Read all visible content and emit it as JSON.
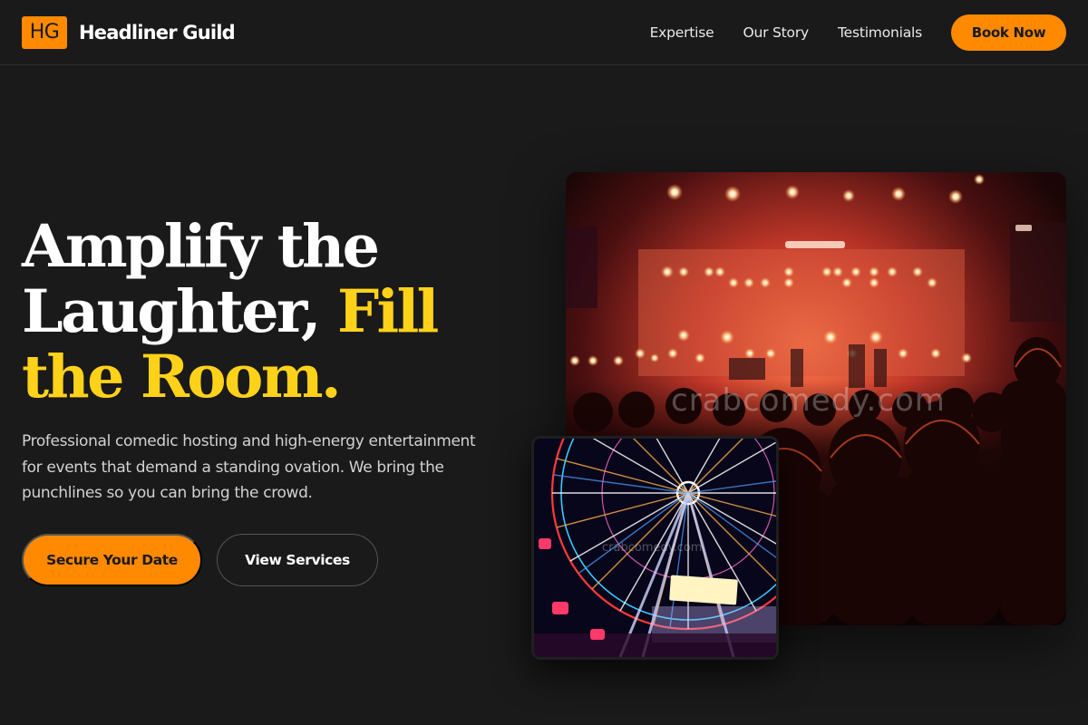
{
  "header": {
    "logo_mark": "HG",
    "brand_name": "Headliner Guild",
    "nav": [
      {
        "label": "Expertise"
      },
      {
        "label": "Our Story"
      },
      {
        "label": "Testimonials"
      }
    ],
    "cta_label": "Book Now"
  },
  "hero": {
    "title_line1": "Amplify the",
    "title_line2_plain": "Laughter, ",
    "title_line2_accent": "Fill",
    "title_line3_accent": "the Room.",
    "subtitle": "Professional comedic hosting and high-energy entertainment for events that demand a standing ovation. We bring the punchlines so you can bring the crowd.",
    "primary_cta": "Secure Your Date",
    "secondary_cta": "View Services"
  },
  "images": {
    "main_watermark": "crabcomedy.com",
    "secondary_watermark": "crabcomedy.com"
  },
  "colors": {
    "background": "#1a1a1b",
    "accent_orange": "#ff8a00",
    "accent_yellow": "#ffd21a",
    "text_primary": "#ffffff",
    "text_secondary": "#d2d2d2"
  }
}
